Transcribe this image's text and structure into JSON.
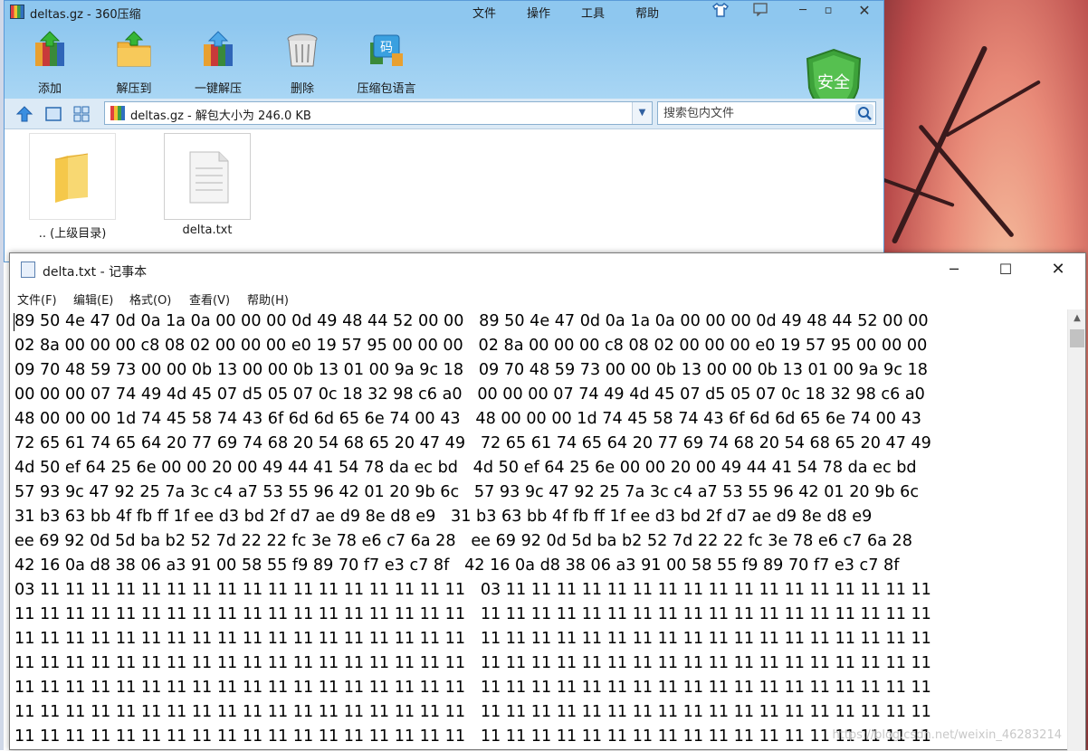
{
  "zip_window": {
    "title": "deltas.gz - 360压缩",
    "menu": [
      "文件",
      "操作",
      "工具",
      "帮助"
    ],
    "toolbar": [
      {
        "label": "添加",
        "icon": "add-archive-icon"
      },
      {
        "label": "解压到",
        "icon": "extract-to-icon"
      },
      {
        "label": "一键解压",
        "icon": "one-click-extract-icon"
      },
      {
        "label": "删除",
        "icon": "trash-icon"
      },
      {
        "label": "压缩包语言",
        "icon": "archive-language-icon"
      }
    ],
    "shield_label": "安全",
    "path": "deltas.gz - 解包大小为 246.0 KB",
    "search_placeholder": "搜索包内文件",
    "files": [
      {
        "label": ".. (上级目录)",
        "icon": "folder-icon"
      },
      {
        "label": "delta.txt",
        "icon": "text-file-icon"
      }
    ]
  },
  "notepad": {
    "title": "delta.txt - 记事本",
    "menu": [
      "文件(F)",
      "编辑(E)",
      "格式(O)",
      "查看(V)",
      "帮助(H)"
    ],
    "lines": [
      "89 50 4e 47 0d 0a 1a 0a 00 00 00 0d 49 48 44 52 00 00   89 50 4e 47 0d 0a 1a 0a 00 00 00 0d 49 48 44 52 00 00",
      "02 8a 00 00 00 c8 08 02 00 00 00 e0 19 57 95 00 00 00   02 8a 00 00 00 c8 08 02 00 00 00 e0 19 57 95 00 00 00",
      "09 70 48 59 73 00 00 0b 13 00 00 0b 13 01 00 9a 9c 18   09 70 48 59 73 00 00 0b 13 00 00 0b 13 01 00 9a 9c 18",
      "00 00 00 07 74 49 4d 45 07 d5 05 07 0c 18 32 98 c6 a0   00 00 00 07 74 49 4d 45 07 d5 05 07 0c 18 32 98 c6 a0",
      "48 00 00 00 1d 74 45 58 74 43 6f 6d 6d 65 6e 74 00 43   48 00 00 00 1d 74 45 58 74 43 6f 6d 6d 65 6e 74 00 43",
      "72 65 61 74 65 64 20 77 69 74 68 20 54 68 65 20 47 49   72 65 61 74 65 64 20 77 69 74 68 20 54 68 65 20 47 49",
      "4d 50 ef 64 25 6e 00 00 20 00 49 44 41 54 78 da ec bd   4d 50 ef 64 25 6e 00 00 20 00 49 44 41 54 78 da ec bd",
      "57 93 9c 47 92 25 7a 3c c4 a7 53 55 96 42 01 20 9b 6c   57 93 9c 47 92 25 7a 3c c4 a7 53 55 96 42 01 20 9b 6c",
      "31 b3 63 bb 4f fb ff 1f ee d3 bd 2f d7 ae d9 8e d8 e9   31 b3 63 bb 4f fb ff 1f ee d3 bd 2f d7 ae d9 8e d8 e9",
      "ee 69 92 0d 5d ba b2 52 7d 22 22 fc 3e 78 e6 c7 6a 28   ee 69 92 0d 5d ba b2 52 7d 22 22 fc 3e 78 e6 c7 6a 28",
      "42 16 0a d8 38 06 a3 91 00 58 55 f9 89 70 f7 e3 c7 8f   42 16 0a d8 38 06 a3 91 00 58 55 f9 89 70 f7 e3 c7 8f",
      "03 11 11 11 11 11 11 11 11 11 11 11 11 11 11 11 11 11   03 11 11 11 11 11 11 11 11 11 11 11 11 11 11 11 11 11",
      "11 11 11 11 11 11 11 11 11 11 11 11 11 11 11 11 11 11   11 11 11 11 11 11 11 11 11 11 11 11 11 11 11 11 11 11",
      "11 11 11 11 11 11 11 11 11 11 11 11 11 11 11 11 11 11   11 11 11 11 11 11 11 11 11 11 11 11 11 11 11 11 11 11",
      "11 11 11 11 11 11 11 11 11 11 11 11 11 11 11 11 11 11   11 11 11 11 11 11 11 11 11 11 11 11 11 11 11 11 11 11",
      "11 11 11 11 11 11 11 11 11 11 11 11 11 11 11 11 11 11   11 11 11 11 11 11 11 11 11 11 11 11 11 11 11 11 11 11",
      "11 11 11 11 11 11 11 11 11 11 11 11 11 11 11 11 11 11   11 11 11 11 11 11 11 11 11 11 11 11 11 11 11 11 11 11",
      "11 11 11 11 11 11 11 11 11 11 11 11 11 11 11 11 11 11   11 11 11 11 11 11 11 11 11 11 11 11 11 11 11 11 11 11"
    ]
  },
  "watermark": "https://blog.csdn.net/weixin_46283214"
}
